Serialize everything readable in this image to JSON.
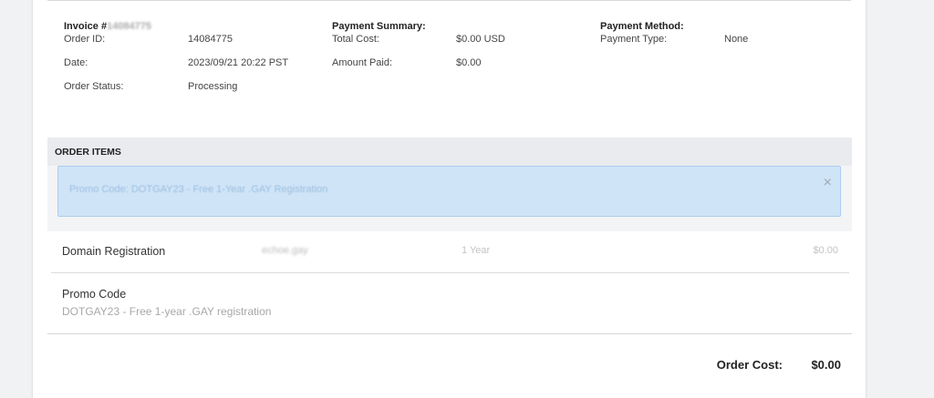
{
  "invoice": {
    "title_prefix": "Invoice #",
    "title_number": "14084775",
    "order_id_label": "Order ID:",
    "order_id": "14084775",
    "date_label": "Date:",
    "date": "2023/09/21 20:22 PST",
    "status_label": "Order Status:",
    "status": "Processing"
  },
  "payment_summary": {
    "heading": "Payment Summary:",
    "total_cost_label": "Total Cost:",
    "total_cost": "$0.00 USD",
    "amount_paid_label": "Amount Paid:",
    "amount_paid": "$0.00"
  },
  "payment_method": {
    "heading": "Payment Method:",
    "type_label": "Payment Type:",
    "type": "None"
  },
  "order_items": {
    "heading": "ORDER ITEMS",
    "alert_text": "Promo Code: DOTGAY23 - Free 1-Year .GAY Registration",
    "alert_close": "×",
    "domain_item": {
      "name": "Domain Registration",
      "domain": "echoe.gay",
      "term": "1 Year",
      "price": "$0.00"
    },
    "promo_item": {
      "name": "Promo Code",
      "description": "DOTGAY23 - Free 1-year .GAY registration"
    }
  },
  "totals": {
    "label": "Order Cost:",
    "value": "$0.00"
  }
}
